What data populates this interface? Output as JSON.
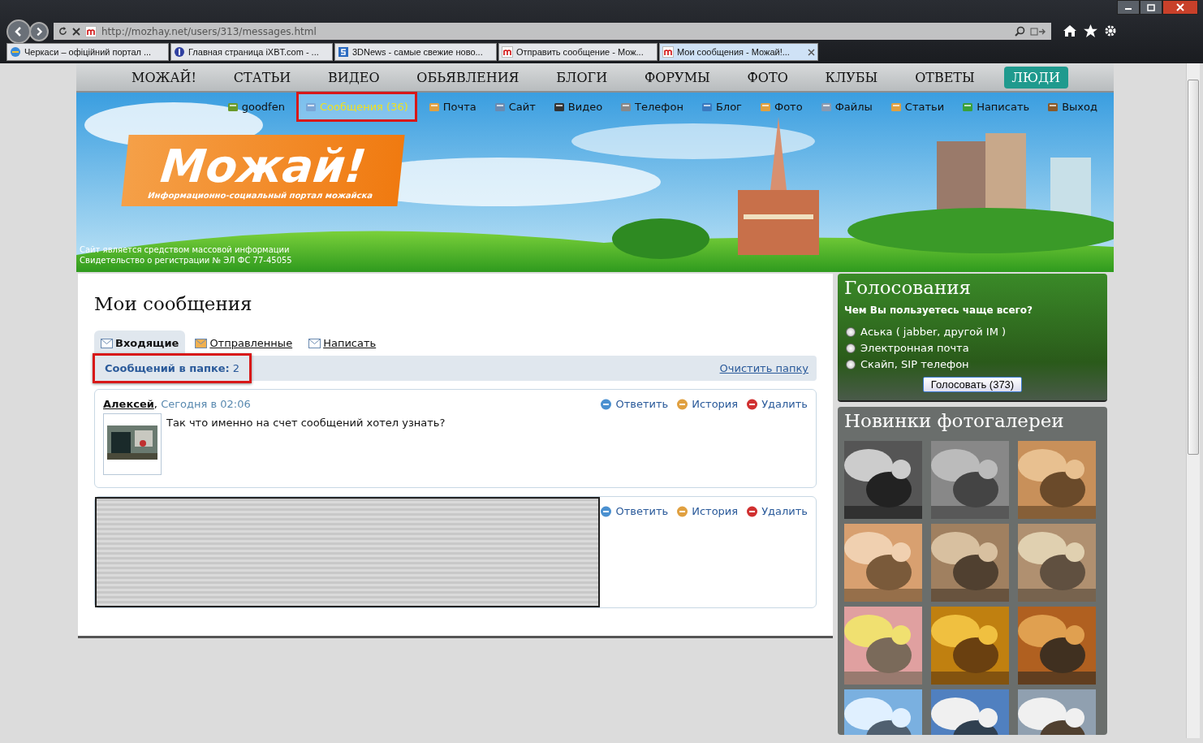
{
  "browser": {
    "url": "http://mozhay.net/users/313/messages.html",
    "tabs": [
      {
        "title": "Черкаси – офіційний портал ...",
        "selected": false
      },
      {
        "title": "Главная страница iXBT.com - ...",
        "selected": false
      },
      {
        "title": "3DNews - самые свежие ново...",
        "selected": false
      },
      {
        "title": "Отправить сообщение - Мож...",
        "selected": false
      },
      {
        "title": "Мои сообщения - Можай!...",
        "selected": true
      }
    ]
  },
  "nav": [
    {
      "label": "МОЖАЙ!",
      "selected": false
    },
    {
      "label": "СТАТЬИ",
      "selected": false
    },
    {
      "label": "ВИДЕО",
      "selected": false
    },
    {
      "label": "ОБЬЯВЛЕНИЯ",
      "selected": false
    },
    {
      "label": "БЛОГИ",
      "selected": false
    },
    {
      "label": "ФОРУМЫ",
      "selected": false
    },
    {
      "label": "ФОТО",
      "selected": false
    },
    {
      "label": "КЛУБЫ",
      "selected": false
    },
    {
      "label": "ОТВЕТЫ",
      "selected": false
    },
    {
      "label": "ЛЮДИ",
      "selected": true
    }
  ],
  "user_links": [
    {
      "label": "goodfen",
      "highlighted": false
    },
    {
      "label": "Сообщения (36)",
      "highlighted": true
    },
    {
      "label": "Почта",
      "highlighted": false
    },
    {
      "label": "Сайт",
      "highlighted": false
    },
    {
      "label": "Видео",
      "highlighted": false
    },
    {
      "label": "Телефон",
      "highlighted": false
    },
    {
      "label": "Блог",
      "highlighted": false
    },
    {
      "label": "Фото",
      "highlighted": false
    },
    {
      "label": "Файлы",
      "highlighted": false
    },
    {
      "label": "Статьи",
      "highlighted": false
    },
    {
      "label": "Написать",
      "highlighted": false
    },
    {
      "label": "Выход",
      "highlighted": false
    }
  ],
  "logo": {
    "title": "Можай!",
    "subtitle": "Информационно-социальный портал можайска"
  },
  "banner_notes": [
    "Сайт является средством массовой информации",
    "Свидетельство о регистрации № ЭЛ ФС 77-45055"
  ],
  "messages_page": {
    "title": "Мои сообщения",
    "tabs": [
      {
        "label": "Входящие",
        "selected": true
      },
      {
        "label": "Отправленные",
        "selected": false
      },
      {
        "label": "Написать",
        "selected": false
      }
    ],
    "folder_count": {
      "label": "Сообщений в папке:",
      "value": "2",
      "highlighted": true
    },
    "clear_link": "Очистить папку",
    "messages": [
      {
        "kind": "message",
        "author": "Алексей",
        "separator": ",",
        "time": "Сегодня в 02:06",
        "text": "Так что именно на счет сообщений хотел узнать?",
        "actions": [
          "Ответить",
          "История",
          "Удалить"
        ]
      },
      {
        "kind": "redacted",
        "actions": [
          "Ответить",
          "История",
          "Удалить"
        ]
      }
    ]
  },
  "poll": {
    "title": "Голосования",
    "question": "Чем Вы пользуетесь чаще всего?",
    "options": [
      {
        "label": "Аська ( jabber, другой IM )",
        "selected": false
      },
      {
        "label": "Электронная почта",
        "selected": false
      },
      {
        "label": "Скайп, SIP телефон",
        "selected": false
      }
    ],
    "button": "Голосовать (373)"
  },
  "gallery": {
    "title": "Новинки фотогалереи"
  }
}
